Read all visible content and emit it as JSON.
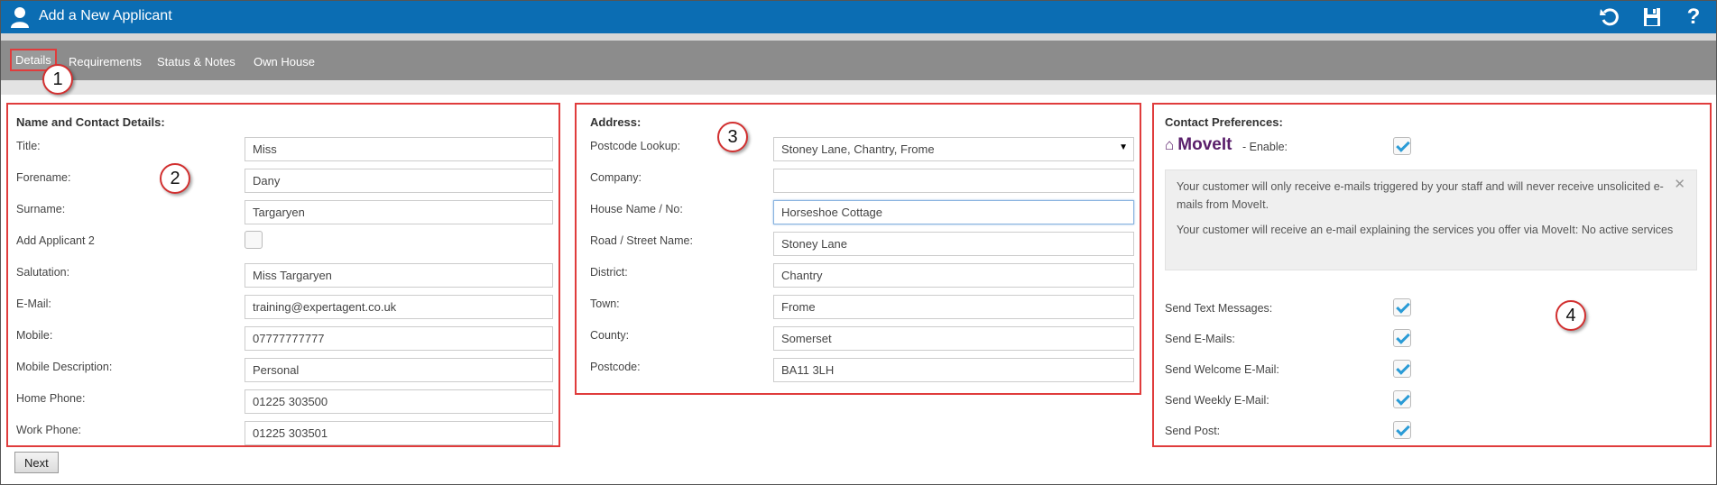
{
  "window": {
    "title": "Add a New Applicant"
  },
  "tabs": [
    {
      "label": "Details",
      "active": true
    },
    {
      "label": "Requirements"
    },
    {
      "label": "Status & Notes"
    },
    {
      "label": "Own House"
    }
  ],
  "callouts": [
    "1",
    "2",
    "3",
    "4"
  ],
  "contact": {
    "heading": "Name and Contact Details:",
    "fields": [
      {
        "label": "Title:",
        "value": "Miss"
      },
      {
        "label": "Forename:",
        "value": "Dany"
      },
      {
        "label": "Surname:",
        "value": "Targaryen"
      },
      {
        "label": "Add Applicant 2",
        "checkbox": true,
        "checked": false
      },
      {
        "label": "Salutation:",
        "value": "Miss Targaryen"
      },
      {
        "label": "E-Mail:",
        "value": "training@expertagent.co.uk"
      },
      {
        "label": "Mobile:",
        "value": "07777777777"
      },
      {
        "label": "Mobile Description:",
        "value": "Personal"
      },
      {
        "label": "Home Phone:",
        "value": "01225 303500"
      },
      {
        "label": "Work Phone:",
        "value": "01225 303501"
      }
    ]
  },
  "address": {
    "heading": "Address:",
    "fields": [
      {
        "label": "Postcode Lookup:",
        "value": "Stoney Lane, Chantry, Frome",
        "select": true
      },
      {
        "label": "Company:",
        "value": ""
      },
      {
        "label": "House Name / No:",
        "value": "Horseshoe Cottage",
        "focused": true
      },
      {
        "label": "Road / Street Name:",
        "value": "Stoney Lane"
      },
      {
        "label": "District:",
        "value": "Chantry"
      },
      {
        "label": "Town:",
        "value": "Frome"
      },
      {
        "label": "County:",
        "value": "Somerset"
      },
      {
        "label": "Postcode:",
        "value": "BA11 3LH"
      }
    ]
  },
  "preferences": {
    "heading": "Contact Preferences:",
    "logo": "MoveIt",
    "enable_label": "- Enable:",
    "enable_checked": true,
    "info": [
      "Your customer will only receive e-mails triggered by your staff and will never receive unsolicited e-mails from MoveIt.",
      "Your customer will receive an e-mail explaining the services you offer via MoveIt: No active services"
    ],
    "options": [
      {
        "label": "Send Text Messages:",
        "checked": true
      },
      {
        "label": "Send E-Mails:",
        "checked": true
      },
      {
        "label": "Send Welcome E-Mail:",
        "checked": true
      },
      {
        "label": "Send Weekly E-Mail:",
        "checked": true
      },
      {
        "label": "Send Post:",
        "checked": true
      }
    ]
  },
  "buttons": {
    "next": "Next"
  },
  "colors": {
    "titlebar": "#0b6db3",
    "tabbar": "#8c8c8c",
    "annotation": "#e03c3c",
    "check": "#2a9bd6",
    "moveit": "#5a1f6b"
  }
}
